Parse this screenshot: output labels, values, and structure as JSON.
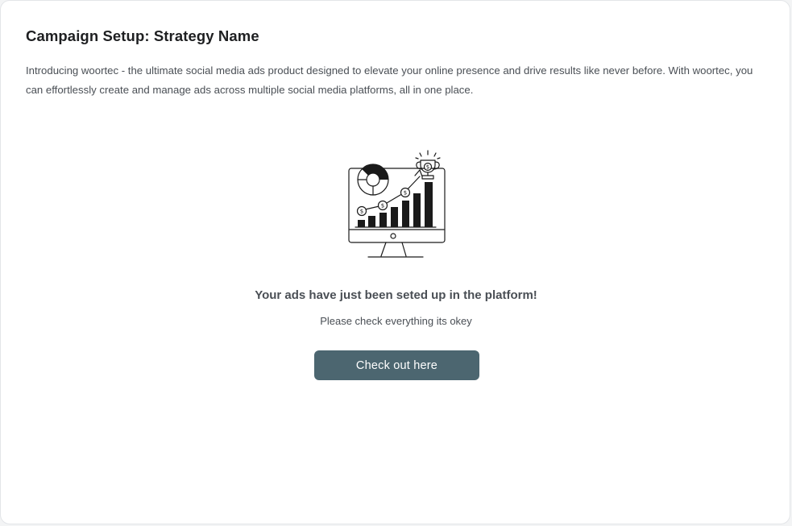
{
  "page": {
    "title": "Campaign Setup: Strategy Name",
    "intro": "Introducing woortec - the ultimate social media ads product designed to elevate your online presence and drive results like never before. With woortec, you can effortlessly create and manage ads across multiple social media platforms, all in one place."
  },
  "success": {
    "illustration_icon": "monitor-growth-chart-trophy-icon",
    "heading": "Your ads have just been seted up in the platform!",
    "subtext": "Please check everything its okey",
    "button_label": "Check out here"
  },
  "colors": {
    "button_bg": "#4c6670",
    "text": "#4a4f55",
    "title": "#1e1f21",
    "card_border": "#e3e5e8"
  }
}
